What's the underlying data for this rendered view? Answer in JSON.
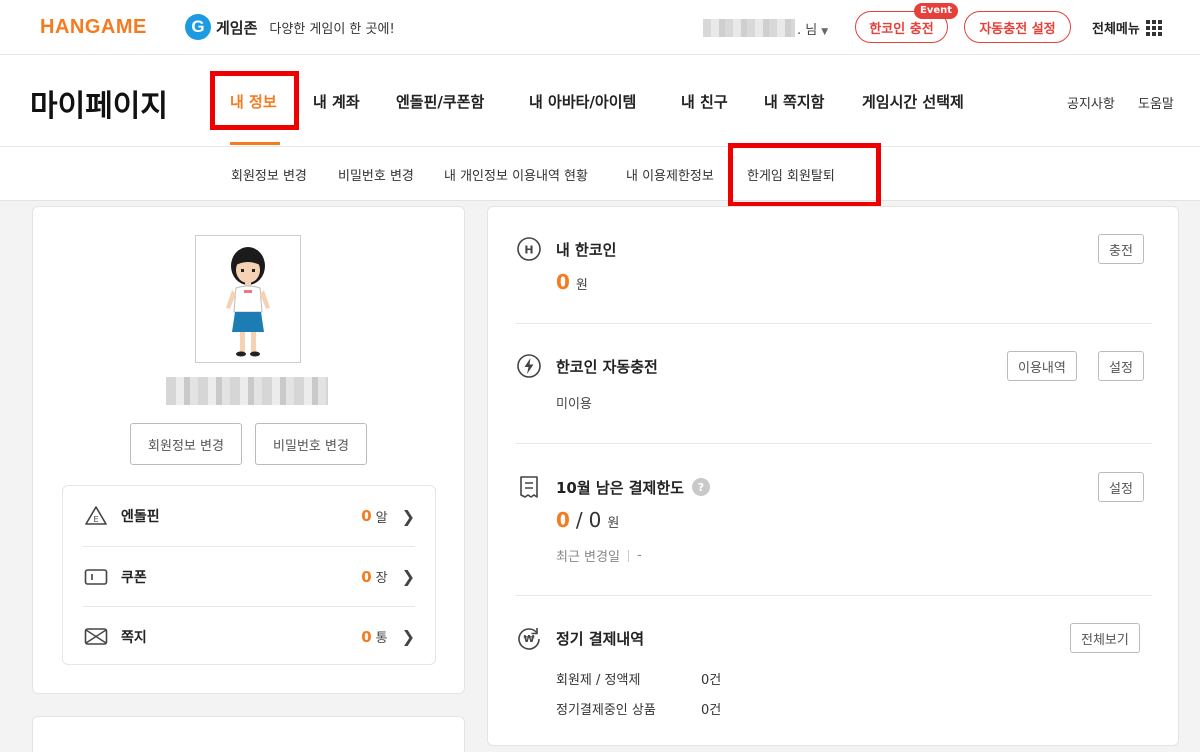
{
  "topbar": {
    "logo": "HANGAME",
    "gamezone_letter": "G",
    "gamezone_name": "게임존",
    "gamezone_tagline": "다양한 게임이 한 곳에!",
    "user_suffix": ". 님",
    "hancoin_charge_label": "한코인 충전",
    "event_badge": "Event",
    "auto_charge_label": "자동충전 설정",
    "all_menu_label": "전체메뉴"
  },
  "header": {
    "title": "마이페이지",
    "tabs": [
      {
        "label": "내 정보"
      },
      {
        "label": "내 계좌"
      },
      {
        "label": "엔돌핀/쿠폰함"
      },
      {
        "label": "내 아바타/아이템"
      },
      {
        "label": "내 친구"
      },
      {
        "label": "내 쪽지함"
      },
      {
        "label": "게임시간 선택제"
      }
    ],
    "notice_label": "공지사항",
    "help_label": "도움말"
  },
  "subnav": {
    "items": [
      {
        "label": "회원정보 변경"
      },
      {
        "label": "비밀번호 변경"
      },
      {
        "label": "내 개인정보 이용내역 현황"
      },
      {
        "label": "내 이용제한정보"
      },
      {
        "label": "한게임 회원탈퇴"
      }
    ]
  },
  "profile": {
    "edit_info_label": "회원정보 변경",
    "change_password_label": "비밀번호 변경"
  },
  "wallet": {
    "items": [
      {
        "label": "엔돌핀",
        "value": "0",
        "unit": "알"
      },
      {
        "label": "쿠폰",
        "value": "0",
        "unit": "장"
      },
      {
        "label": "쪽지",
        "value": "0",
        "unit": "통"
      }
    ]
  },
  "right": {
    "hancoin": {
      "title": "내 한코인",
      "value": "0",
      "unit": "원",
      "charge_label": "충전"
    },
    "auto_charge": {
      "title": "한코인 자동충전",
      "status": "미이용",
      "history_label": "이용내역",
      "setting_label": "설정"
    },
    "limit": {
      "title": "10월 남은 결제한도",
      "help_glyph": "?",
      "used": "0",
      "separator": "/",
      "total": "0",
      "unit": "원",
      "recent_label": "최근 변경일",
      "recent_value": "-",
      "setting_label": "설정"
    },
    "recurring": {
      "title": "정기 결제내역",
      "view_all_label": "전체보기",
      "rows": [
        {
          "label": "회원제 / 정액제",
          "value": "0건"
        },
        {
          "label": "정기결제중인 상품",
          "value": "0건"
        }
      ]
    }
  },
  "colors": {
    "accent": "#f47b20",
    "highlight": "#ee0000",
    "event": "#e5403a",
    "gamezone": "#1e9be0"
  }
}
